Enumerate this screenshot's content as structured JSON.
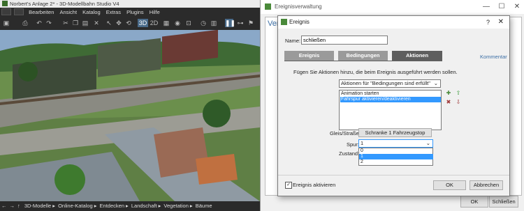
{
  "app": {
    "title": "Norbert's Anlage 2* - 3D-Modellbahn Studio V4",
    "menu": [
      "Bearbeiten",
      "Ansicht",
      "Katalog",
      "Extras",
      "Plugins",
      "Hilfe"
    ],
    "toolbar": {
      "view_3d": "3D",
      "view_2d": "2D"
    },
    "status": [
      "3D-Modelle",
      "Online-Katalog",
      "Entdecken",
      "Landschaft",
      "Vegetation",
      "Bäume"
    ]
  },
  "manager": {
    "title": "Ereignisverwaltung",
    "heading": "Ver",
    "ok": "OK",
    "close": "Schließen"
  },
  "dialog": {
    "title": "Ereignis",
    "help": "?",
    "name_label": "Name:",
    "name_value": "schließen",
    "tabs": [
      "Ereignis",
      "Bedingungen",
      "Aktionen"
    ],
    "comment_link": "Kommentar",
    "hint": "Fügen Sie Aktionen hinzu, die beim Ereignis ausgeführt werden sollen.",
    "action_mode": "Aktionen für \"Bedingungen sind erfüllt\"",
    "actions": [
      "Animation starten",
      "Fahrspur aktivieren/deaktivieren"
    ],
    "track_label": "Gleis/Straße:",
    "track_value": "Schranke 1 Fahrzeugstop",
    "lane_label": "Spur:",
    "lane_value": "1",
    "lane_options": [
      "0",
      "1",
      "2"
    ],
    "state_label": "Zustand:",
    "enable_label": "Ereignis aktivieren",
    "enabled": true,
    "ok": "OK",
    "cancel": "Abbrechen"
  },
  "colors": {
    "accent": "#3399ff",
    "tab_active": "#5e5e5e",
    "tab_inactive": "#9a9a9a",
    "link": "#3b6ea5"
  }
}
